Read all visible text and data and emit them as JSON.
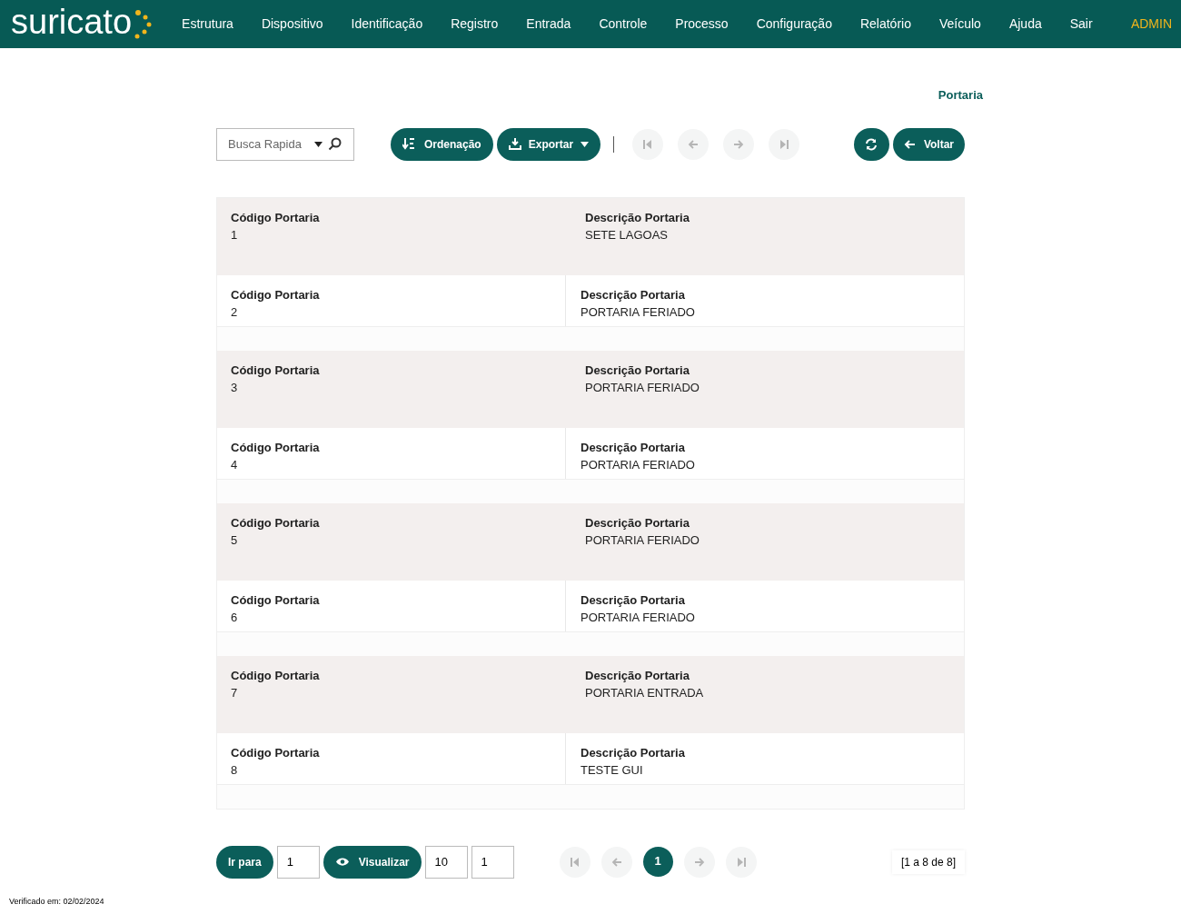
{
  "brand": {
    "name": "suricato"
  },
  "menu": [
    {
      "label": "Estrutura"
    },
    {
      "label": "Dispositivo"
    },
    {
      "label": "Identificação"
    },
    {
      "label": "Registro"
    },
    {
      "label": "Entrada"
    },
    {
      "label": "Controle"
    },
    {
      "label": "Processo"
    },
    {
      "label": "Configuração"
    },
    {
      "label": "Relatório"
    },
    {
      "label": "Veículo"
    },
    {
      "label": "Ajuda"
    },
    {
      "label": "Sair"
    }
  ],
  "user": "ADMIN",
  "page_title": "Portaria",
  "toolbar": {
    "search": {
      "placeholder": "Busca Rapida"
    },
    "sort_button": "Ordenação",
    "export_button": "Exportar",
    "nav": [
      {
        "kind": "first",
        "disabled": true
      },
      {
        "kind": "prev",
        "disabled": true
      },
      {
        "kind": "next",
        "disabled": true
      },
      {
        "kind": "last",
        "disabled": true
      }
    ],
    "back_button": "Voltar"
  },
  "records": [
    {
      "fields": [
        {
          "label": "Código Portaria",
          "value": "1"
        },
        {
          "label": "Descrição Portaria",
          "value": "SETE LAGOAS"
        }
      ]
    },
    {
      "fields": [
        {
          "label": "Código Portaria",
          "value": "2"
        },
        {
          "label": "Descrição Portaria",
          "value": "PORTARIA FERIADO"
        }
      ]
    },
    {
      "fields": [
        {
          "label": "Código Portaria",
          "value": "3"
        },
        {
          "label": "Descrição Portaria",
          "value": "PORTARIA FERIADO"
        }
      ]
    },
    {
      "fields": [
        {
          "label": "Código Portaria",
          "value": "4"
        },
        {
          "label": "Descrição Portaria",
          "value": "PORTARIA FERIADO"
        }
      ]
    },
    {
      "fields": [
        {
          "label": "Código Portaria",
          "value": "5"
        },
        {
          "label": "Descrição Portaria",
          "value": "PORTARIA FERIADO"
        }
      ]
    },
    {
      "fields": [
        {
          "label": "Código Portaria",
          "value": "6"
        },
        {
          "label": "Descrição Portaria",
          "value": "PORTARIA FERIADO"
        }
      ]
    },
    {
      "fields": [
        {
          "label": "Código Portaria",
          "value": "7"
        },
        {
          "label": "Descrição Portaria",
          "value": "PORTARIA ENTRADA"
        }
      ]
    },
    {
      "fields": [
        {
          "label": "Código Portaria",
          "value": "8"
        },
        {
          "label": "Descrição Portaria",
          "value": "TESTE GUI"
        }
      ]
    }
  ],
  "footer": {
    "goto_button": "Ir para",
    "goto_value": "1",
    "view_button": "Visualizar",
    "per_page_value": "10",
    "page_value": "1",
    "pager": [
      {
        "kind": "first",
        "disabled": true
      },
      {
        "kind": "prev",
        "disabled": true
      },
      {
        "kind": "page",
        "label": "1",
        "selected": true
      },
      {
        "kind": "next",
        "disabled": true
      },
      {
        "kind": "last",
        "disabled": true
      }
    ],
    "summary": "[1 a 8 de 8]"
  },
  "verified": "Verificado em: 02/02/2024"
}
